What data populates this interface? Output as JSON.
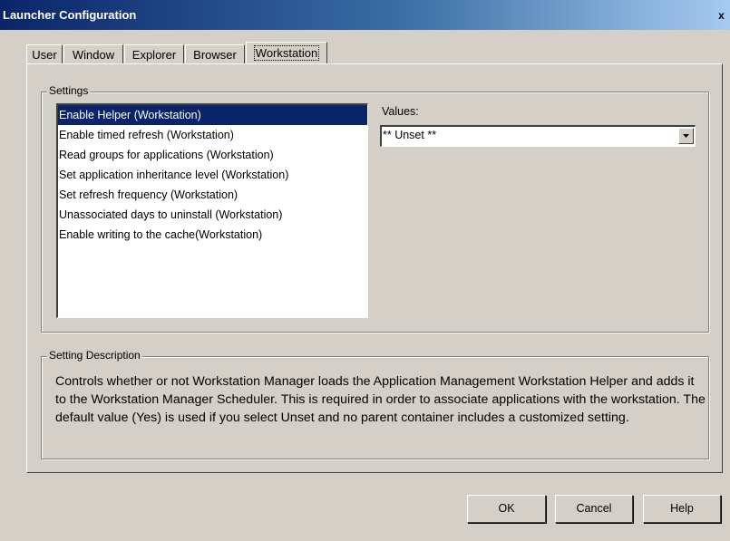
{
  "window": {
    "title": "Launcher Configuration",
    "close_glyph": "x"
  },
  "tabs": [
    {
      "label": "User"
    },
    {
      "label": "Window"
    },
    {
      "label": "Explorer"
    },
    {
      "label": "Browser"
    },
    {
      "label": "Workstation",
      "active": true
    }
  ],
  "settings": {
    "group_label": "Settings",
    "items": [
      {
        "label": "Enable Helper (Workstation)",
        "selected": true
      },
      {
        "label": "Enable timed refresh (Workstation)"
      },
      {
        "label": "Read groups for applications (Workstation)"
      },
      {
        "label": "Set application inheritance level (Workstation)"
      },
      {
        "label": "Set refresh frequency (Workstation)"
      },
      {
        "label": "Unassociated days to uninstall (Workstation)"
      },
      {
        "label": "Enable writing to the cache(Workstation)"
      }
    ],
    "values_label": "Values:",
    "values_selected": "** Unset **"
  },
  "description": {
    "group_label": "Setting Description",
    "text": "Controls whether or not Workstation Manager loads the Application Management Workstation Helper and adds it to the Workstation Manager Scheduler. This is required in order to associate applications with the workstation. The default value (Yes) is used if you select Unset and no parent container includes a customized setting."
  },
  "buttons": {
    "ok": "OK",
    "cancel": "Cancel",
    "help": "Help"
  },
  "icons": {
    "dropdown": "chevron-down-icon",
    "close": "close-icon"
  },
  "colors": {
    "title_start": "#0a246a",
    "title_end": "#a6caf0",
    "selection": "#0a246a",
    "face": "#d4d0c8"
  }
}
